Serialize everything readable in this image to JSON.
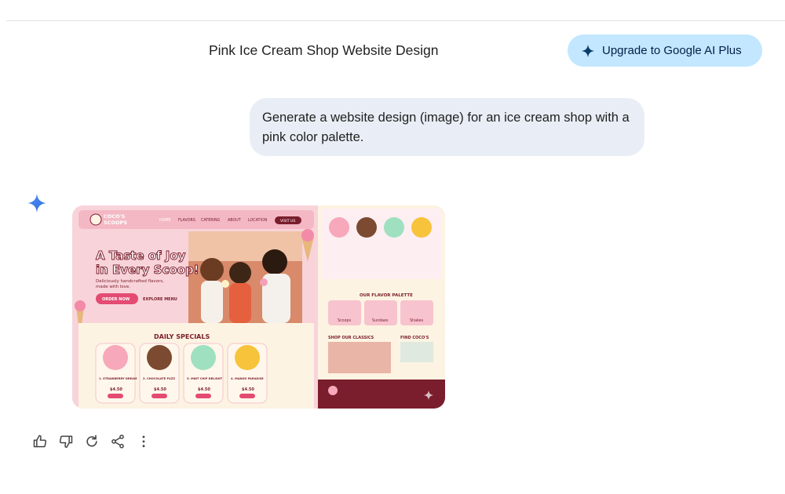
{
  "header": {
    "title": "Pink Ice Cream Shop Website Design",
    "upgrade_label": "Upgrade to Google AI Plus"
  },
  "user_message": "Generate a website design (image) for an ice cream shop with a pink color palette.",
  "generated_image": {
    "brand": [
      "COCO'S",
      "SCOOPS"
    ],
    "nav": [
      "HOME",
      "FLAVORS",
      "CATERING",
      "ABOUT",
      "LOCATION"
    ],
    "visit_label": "VISIT US",
    "hero_title_1": "A Taste of Joy",
    "hero_title_2": "in Every Scoop!",
    "hero_sub_1": "Deliciously handcrafted flavors,",
    "hero_sub_2": "made with love.",
    "order_label": "ORDER NOW",
    "explore_label": "EXPLORE MENU",
    "specials_title": "DAILY SPECIALS",
    "specials": [
      {
        "name": "1. STRAWBERRY DREAM",
        "price": "$4.50"
      },
      {
        "name": "2. CHOCOLATE FUZZ",
        "price": "$4.50"
      },
      {
        "name": "3. MINT CHIP DELIGHT",
        "price": "$4.50"
      },
      {
        "name": "4. MANGO PARADISE",
        "price": "$4.50"
      }
    ],
    "palette_title": "OUR FLAVOR PALETTE",
    "palette": [
      "Scoops",
      "Sundaes",
      "Shakes"
    ],
    "classics_title": "SHOP OUR CLASSICS",
    "find_title": "FIND COCO'S",
    "colors": {
      "pink": "#f8c9d3",
      "deep": "#7a1d2c",
      "cream": "#fdf4e3",
      "accent": "#e44b73"
    }
  },
  "actions": {
    "thumbs_up": "thumbs-up-icon",
    "thumbs_down": "thumbs-down-icon",
    "redo": "redo-icon",
    "share": "share-icon",
    "more": "more-vert-icon"
  }
}
